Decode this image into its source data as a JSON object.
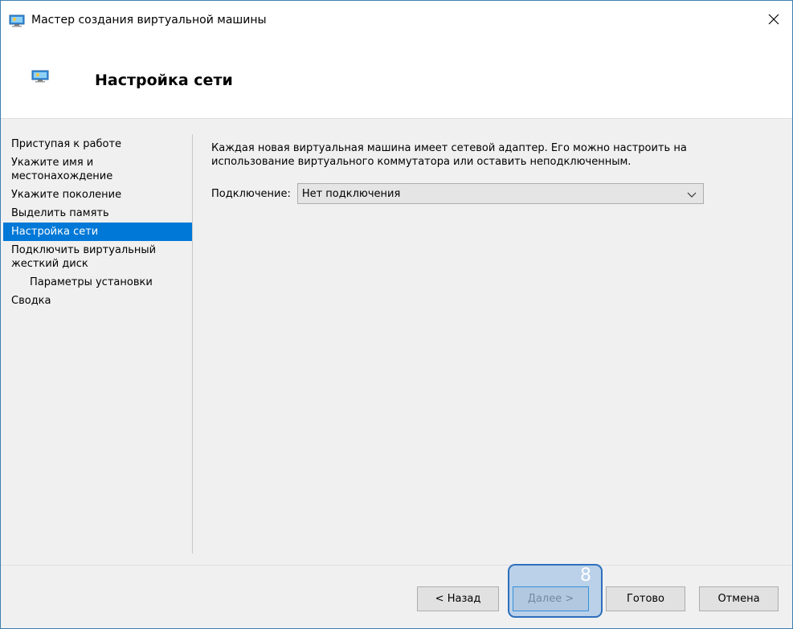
{
  "window": {
    "title": "Мастер создания виртуальной машины"
  },
  "header": {
    "title": "Настройка сети"
  },
  "sidebar": {
    "items": [
      {
        "label": "Приступая к работе"
      },
      {
        "label": "Укажите имя и местонахождение"
      },
      {
        "label": "Укажите поколение"
      },
      {
        "label": "Выделить память"
      },
      {
        "label": "Настройка сети"
      },
      {
        "label": "Подключить виртуальный жесткий диск"
      },
      {
        "label": "Параметры установки"
      },
      {
        "label": "Сводка"
      }
    ],
    "active_index": 4
  },
  "content": {
    "description": "Каждая новая виртуальная машина имеет сетевой адаптер. Его можно настроить на использование виртуального коммутатора или оставить неподключенным.",
    "connection_label": "Подключение:",
    "connection_value": "Нет подключения"
  },
  "footer": {
    "back_label": "< Назад",
    "next_label": "Далее >",
    "finish_label": "Готово",
    "cancel_label": "Отмена"
  },
  "annotation": {
    "step_number": "8"
  },
  "colors": {
    "accent": "#0078d7",
    "window_border": "#3c7fb1",
    "background": "#f0f0f0",
    "callout_border": "#2d6fbd"
  },
  "icons": [
    "vm-icon",
    "close-icon",
    "chevron-down-icon"
  ]
}
